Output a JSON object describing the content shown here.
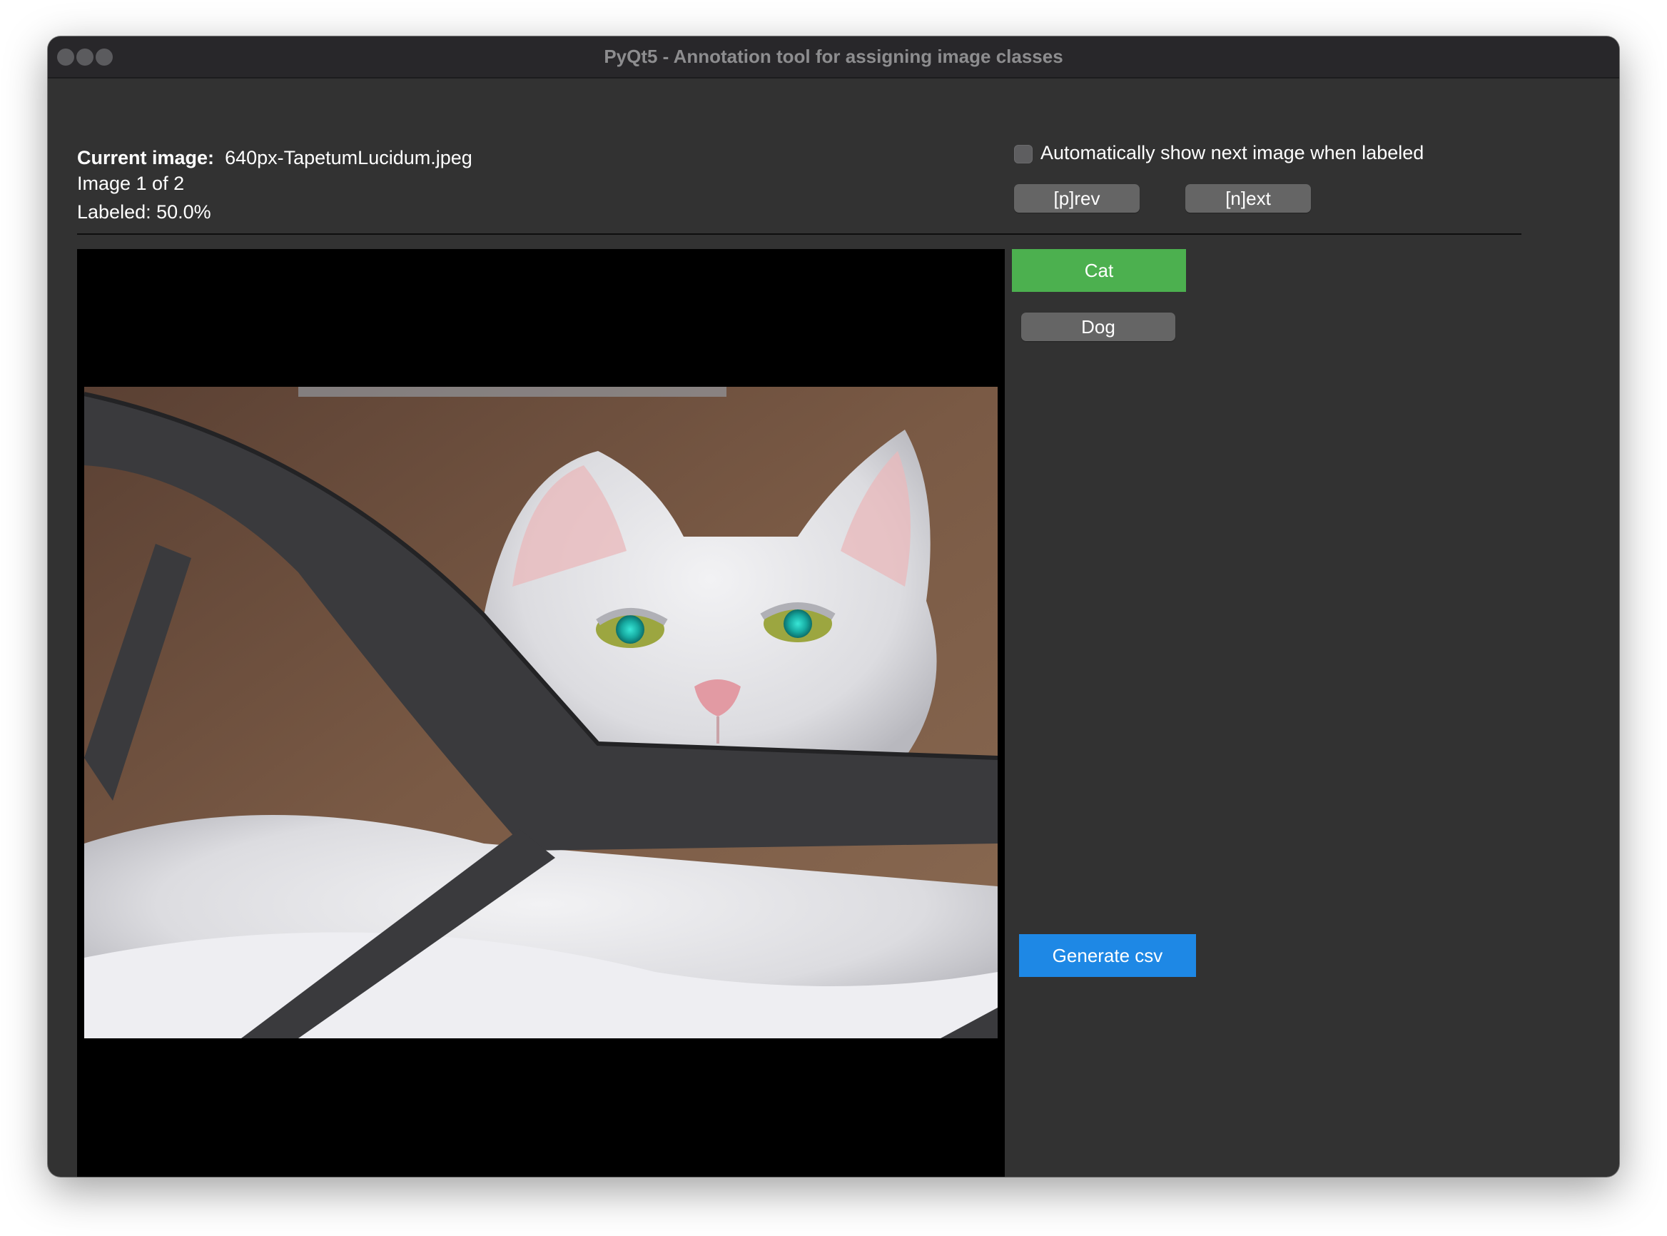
{
  "window": {
    "title": "PyQt5 - Annotation tool for assigning image classes"
  },
  "info": {
    "current_image_label": "Current image:",
    "current_image_name": "640px-TapetumLucidum.jpeg",
    "image_counter": "Image 1 of 2",
    "labeled_progress": "Labeled: 50.0%"
  },
  "controls": {
    "auto_next_label": "Automatically show next image when labeled",
    "auto_next_checked": false,
    "prev_label": "[p]rev",
    "next_label": "[n]ext"
  },
  "classes": [
    {
      "label": "Cat",
      "selected": true,
      "color": "#4cb04f"
    },
    {
      "label": "Dog",
      "selected": false,
      "color": "#656565"
    }
  ],
  "actions": {
    "generate_csv_label": "Generate csv",
    "generate_csv_color": "#1e88e5"
  },
  "image": {
    "subject": "white cat with glowing teal eyes behind a black metal chair frame"
  }
}
